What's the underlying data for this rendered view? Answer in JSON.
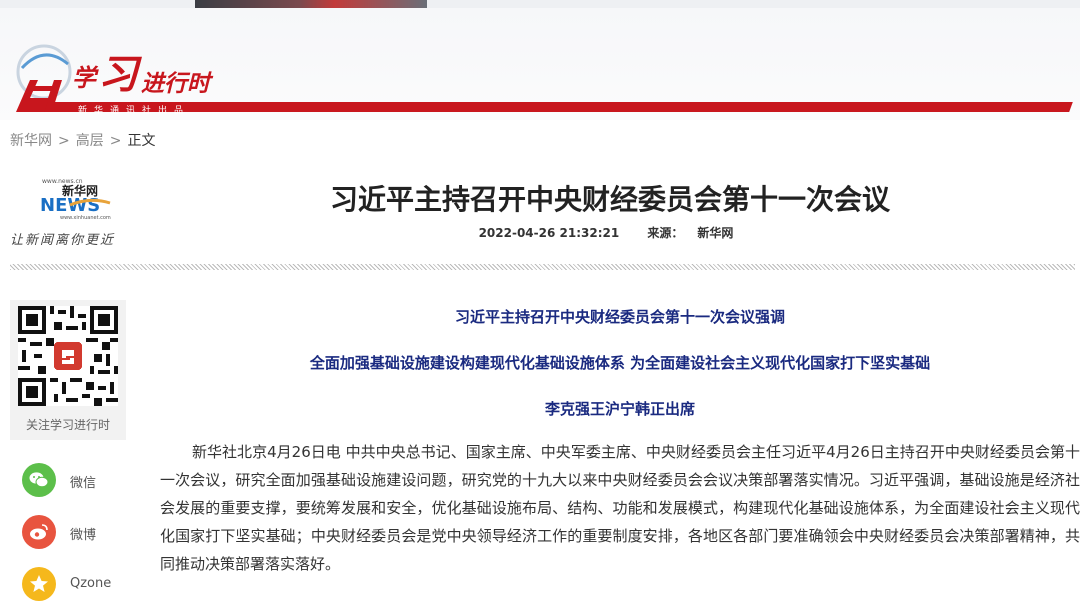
{
  "header": {
    "logo_char_xue": "学",
    "logo_char_xi": "习",
    "logo_rest": "进行时",
    "publisher": "新华通讯社出品"
  },
  "breadcrumb": {
    "items": [
      "新华网",
      "高层",
      "正文"
    ],
    "separator": ">"
  },
  "source_logo": {
    "url_text": "www.news.cn",
    "name": "新华网",
    "letters": "NEWS",
    "sub_url": "www.xinhuanet.com",
    "slogan": "让新闻离你更近"
  },
  "article": {
    "title": "习近平主持召开中央财经委员会第十一次会议",
    "datetime": "2022-04-26 21:32:21",
    "source_label": "来源：",
    "source_value": "新华网",
    "subheadings": [
      "习近平主持召开中央财经委员会第十一次会议强调",
      "全面加强基础设施建设构建现代化基础设施体系 为全面建设社会主义现代化国家打下坚实基础",
      "李克强王沪宁韩正出席"
    ],
    "body": "新华社北京4月26日电 中共中央总书记、国家主席、中央军委主席、中央财经委员会主任习近平4月26日主持召开中央财经委员会第十一次会议，研究全面加强基础设施建设问题，研究党的十九大以来中央财经委员会会议决策部署落实情况。习近平强调，基础设施是经济社会发展的重要支撑，要统筹发展和安全，优化基础设施布局、结构、功能和发展模式，构建现代化基础设施体系，为全面建设社会主义现代化国家打下坚实基础；中央财经委员会是党中央领导经济工作的重要制度安排，各地区各部门要准确领会中央财经委员会决策部署精神，共同推动决策部署落实落好。"
  },
  "sidebar": {
    "qr_label": "关注学习进行时",
    "share": [
      {
        "label": "微信",
        "icon": "wechat-icon",
        "color": "#5cbf4a"
      },
      {
        "label": "微博",
        "icon": "weibo-icon",
        "color": "#e8543f"
      },
      {
        "label": "Qzone",
        "icon": "qzone-icon",
        "color": "#f5b81c"
      }
    ]
  },
  "colors": {
    "brand_red": "#c8161d",
    "subheading_blue": "#1a2a80"
  }
}
